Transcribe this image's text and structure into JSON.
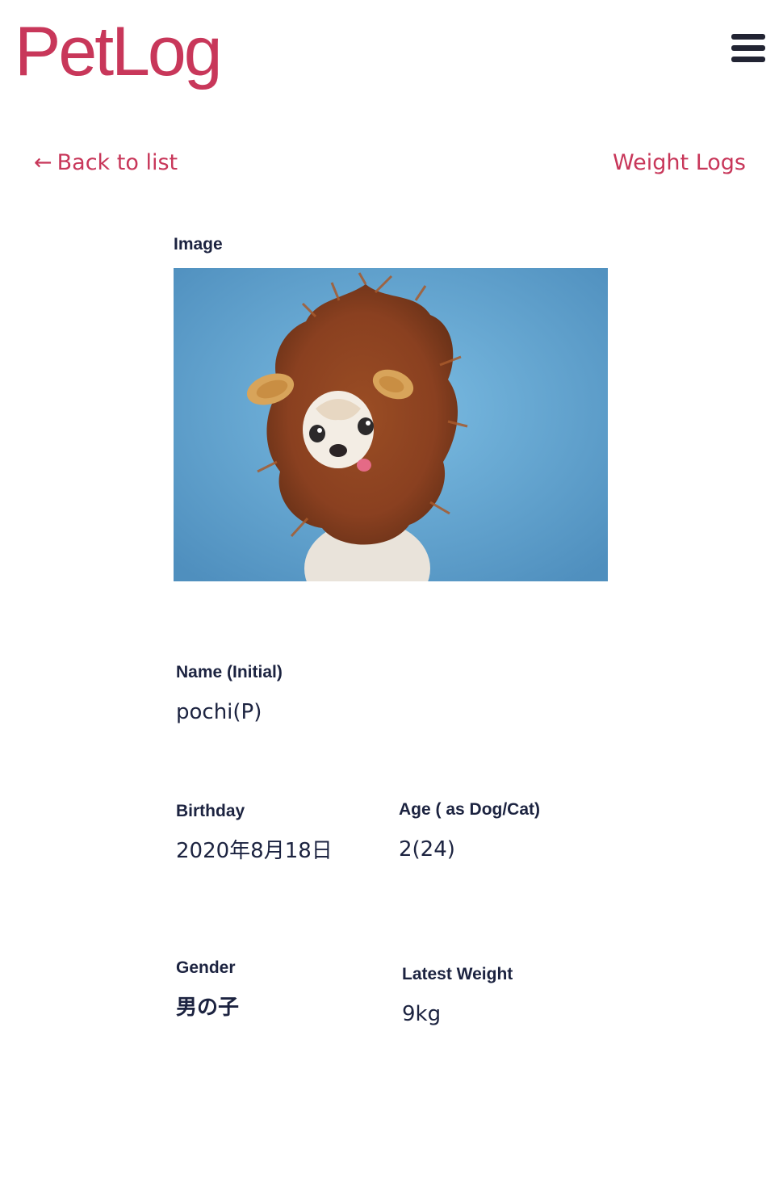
{
  "header": {
    "logo": "PetLog",
    "menu_icon": "hamburger-menu-icon"
  },
  "nav": {
    "back_arrow": "←",
    "back_label": "Back to list",
    "weight_logs_label": "Weight Logs"
  },
  "pet": {
    "image_label": "Image",
    "name_label": "Name (Initial)",
    "name_value": "pochi(P)",
    "birthday_label": "Birthday",
    "birthday_value": "2020年8月18日",
    "age_label": "Age ( as Dog/Cat)",
    "age_value": "2(24)",
    "gender_label": "Gender",
    "gender_value": "男の子",
    "weight_label": "Latest Weight",
    "weight_value": "9kg"
  },
  "colors": {
    "brand": "#c8375a",
    "text": "#1c2340",
    "photo_background": "#6aa9d6"
  }
}
